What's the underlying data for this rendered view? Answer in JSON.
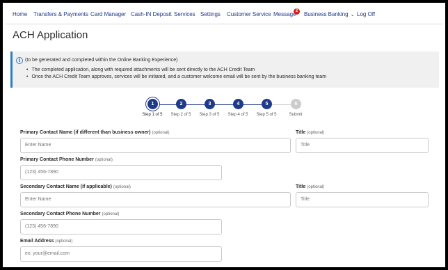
{
  "nav": {
    "items": [
      "Home",
      "Transfers & Payments",
      "Card Manager",
      "Cash-IN Deposit",
      "Services",
      "Settings",
      "Customer Service",
      "Message",
      "Business Banking",
      "Log Off"
    ],
    "message_badge": "2"
  },
  "page": {
    "title": "ACH Application"
  },
  "notice": {
    "intro": "(to be generated and completed within the Online Banking Experience)",
    "bullets": [
      "The completed application, along with required attachments will be sent directly to the ACH Credit Team",
      "Once the ACH Credit Team approves, services will be initiated, and a customer welcome email will be sent by the business banking team"
    ]
  },
  "stepper": {
    "steps": [
      {
        "number": "1",
        "label": "Step 1 of 5",
        "state": "active"
      },
      {
        "number": "2",
        "label": "Step 2 of 5",
        "state": "complete"
      },
      {
        "number": "3",
        "label": "Step 3 of 5",
        "state": "complete"
      },
      {
        "number": "4",
        "label": "Step 4 of 5",
        "state": "complete"
      },
      {
        "number": "5",
        "label": "Step 5 of 5",
        "state": "complete"
      },
      {
        "number": "6",
        "label": "Submit",
        "state": "pending"
      }
    ]
  },
  "form": {
    "optional_text": "(optional)",
    "primary_name": {
      "label": "Primary Contact Name (if different than business owner)",
      "placeholder": "Enter Name"
    },
    "primary_title": {
      "label": "Title",
      "placeholder": "Title"
    },
    "primary_phone": {
      "label": "Primary Contact Phone Number",
      "placeholder": "(123) 456-7890"
    },
    "secondary_name": {
      "label": "Secondary Contact Name (if applicable)",
      "placeholder": "Enter Name"
    },
    "secondary_title": {
      "label": "Title",
      "placeholder": "Title"
    },
    "secondary_phone": {
      "label": "Secondary Contact Phone Number",
      "placeholder": "(123) 456-7890"
    },
    "email": {
      "label": "Email Address",
      "placeholder": "ex: your@email.com"
    }
  },
  "colors": {
    "brand_navy": "#1f3a8a",
    "badge_red": "#d71a1a",
    "info_blue": "#2d7fc2",
    "pending_grey": "#cccccc"
  }
}
